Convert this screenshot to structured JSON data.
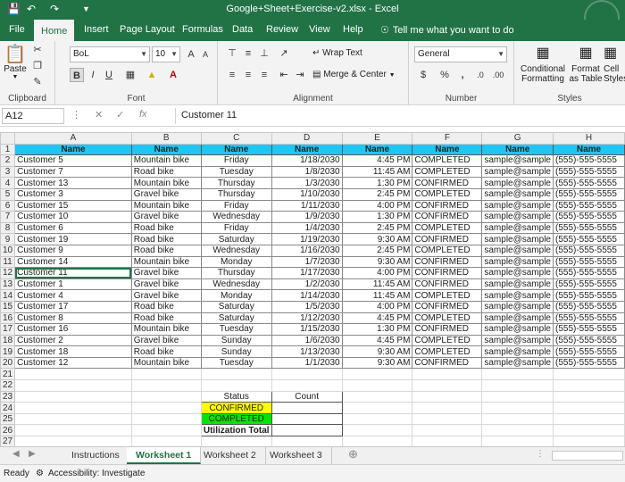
{
  "titlebar": {
    "title": "Google+Sheet+Exercise-v2.xlsx  -  Excel",
    "save_icon": "save-icon",
    "undo_icon": "undo-icon",
    "redo_icon": "redo-icon"
  },
  "tabs": [
    "File",
    "Home",
    "Insert",
    "Page Layout",
    "Formulas",
    "Data",
    "Review",
    "View",
    "Help"
  ],
  "tell_me": "Tell me what you want to do",
  "ribbon": {
    "clipboard": {
      "paste": "Paste",
      "label": "Clipboard"
    },
    "font": {
      "name": "BoL",
      "size": "10",
      "label": "Font"
    },
    "alignment": {
      "wrap": "Wrap Text",
      "merge": "Merge & Center",
      "label": "Alignment"
    },
    "number": {
      "format": "General",
      "label": "Number"
    },
    "styles": {
      "conditional": "Conditional Formatting",
      "format_table": "Format as Table",
      "cell": "Cell Styles",
      "label": "Styles"
    }
  },
  "formula_bar": {
    "name_box": "A12",
    "content": "Customer 11"
  },
  "columns": [
    "A",
    "B",
    "C",
    "D",
    "E",
    "F",
    "G",
    "H"
  ],
  "headers": [
    "Name",
    "Name",
    "Name",
    "Name",
    "Name",
    "Name",
    "Name",
    "Name"
  ],
  "rows": [
    [
      "Customer 5",
      "Mountain bike",
      "Friday",
      "1/18/2030",
      "4:45 PM",
      "COMPLETED",
      "sample@sample",
      "(555)-555-5555"
    ],
    [
      "Customer 7",
      "Road bike",
      "Tuesday",
      "1/8/2030",
      "11:45 AM",
      "COMPLETED",
      "sample@sample",
      "(555)-555-5555"
    ],
    [
      "Customer 13",
      "Mountain bike",
      "Thursday",
      "1/3/2030",
      "1:30 PM",
      "CONFIRMED",
      "sample@sample",
      "(555)-555-5555"
    ],
    [
      "Customer 3",
      "Gravel bike",
      "Thursday",
      "1/10/2030",
      "2:45 PM",
      "COMPLETED",
      "sample@sample",
      "(555)-555-5555"
    ],
    [
      "Customer 15",
      "Mountain bike",
      "Friday",
      "1/11/2030",
      "4:00 PM",
      "CONFIRMED",
      "sample@sample",
      "(555)-555-5555"
    ],
    [
      "Customer 10",
      "Gravel bike",
      "Wednesday",
      "1/9/2030",
      "1:30 PM",
      "CONFIRMED",
      "sample@sample",
      "(555)-555-5555"
    ],
    [
      "Customer 6",
      "Road bike",
      "Friday",
      "1/4/2030",
      "2:45 PM",
      "COMPLETED",
      "sample@sample",
      "(555)-555-5555"
    ],
    [
      "Customer 19",
      "Road bike",
      "Saturday",
      "1/19/2030",
      "9:30 AM",
      "CONFIRMED",
      "sample@sample",
      "(555)-555-5555"
    ],
    [
      "Customer 9",
      "Road bike",
      "Wednesday",
      "1/16/2030",
      "2:45 PM",
      "COMPLETED",
      "sample@sample",
      "(555)-555-5555"
    ],
    [
      "Customer 14",
      "Mountain bike",
      "Monday",
      "1/7/2030",
      "9:30 AM",
      "CONFIRMED",
      "sample@sample",
      "(555)-555-5555"
    ],
    [
      "Customer 11",
      "Gravel bike",
      "Thursday",
      "1/17/2030",
      "4:00 PM",
      "CONFIRMED",
      "sample@sample",
      "(555)-555-5555"
    ],
    [
      "Customer 1",
      "Gravel bike",
      "Wednesday",
      "1/2/2030",
      "11:45 AM",
      "CONFIRMED",
      "sample@sample",
      "(555)-555-5555"
    ],
    [
      "Customer 4",
      "Gravel bike",
      "Monday",
      "1/14/2030",
      "11:45 AM",
      "COMPLETED",
      "sample@sample",
      "(555)-555-5555"
    ],
    [
      "Customer 17",
      "Road bike",
      "Saturday",
      "1/5/2030",
      "4:00 PM",
      "CONFIRMED",
      "sample@sample",
      "(555)-555-5555"
    ],
    [
      "Customer 8",
      "Road bike",
      "Saturday",
      "1/12/2030",
      "4:45 PM",
      "COMPLETED",
      "sample@sample",
      "(555)-555-5555"
    ],
    [
      "Customer 16",
      "Mountain bike",
      "Tuesday",
      "1/15/2030",
      "1:30 PM",
      "CONFIRMED",
      "sample@sample",
      "(555)-555-5555"
    ],
    [
      "Customer 2",
      "Gravel bike",
      "Sunday",
      "1/6/2030",
      "4:45 PM",
      "COMPLETED",
      "sample@sample",
      "(555)-555-5555"
    ],
    [
      "Customer 18",
      "Road bike",
      "Sunday",
      "1/13/2030",
      "9:30 AM",
      "COMPLETED",
      "sample@sample",
      "(555)-555-5555"
    ],
    [
      "Customer 12",
      "Mountain bike",
      "Tuesday",
      "1/1/2030",
      "9:30 AM",
      "CONFIRMED",
      "sample@sample",
      "(555)-555-5555"
    ]
  ],
  "row_numbers": [
    "1",
    "2",
    "3",
    "4",
    "5",
    "6",
    "7",
    "8",
    "9",
    "10",
    "11",
    "12",
    "13",
    "14",
    "15",
    "16",
    "17",
    "18",
    "19",
    "20",
    "21",
    "22",
    "23",
    "24",
    "25",
    "26",
    "27"
  ],
  "summary": {
    "status_header": "Status",
    "count_header": "Count",
    "confirmed": "CONFIRMED",
    "completed": "COMPLETED",
    "utilization": "Utilization Total"
  },
  "sheet_tabs": [
    "Instructions",
    "Worksheet 1",
    "Worksheet 2",
    "Worksheet 3"
  ],
  "active_sheet": "Worksheet 1",
  "status": {
    "ready": "Ready",
    "accessibility": "Accessibility: Investigate"
  },
  "colors": {
    "excel_green": "#217346",
    "header_blue": "#21c5f3",
    "confirmed_yellow": "#ffff00",
    "completed_green": "#00e600"
  }
}
